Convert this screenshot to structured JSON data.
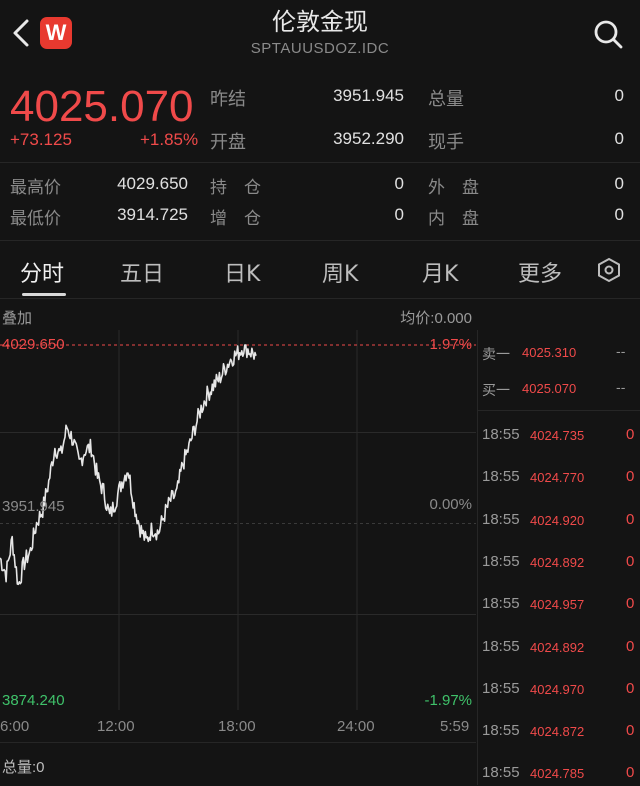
{
  "header": {
    "title": "伦敦金现",
    "code": "SPTAUUSDOZ.IDC",
    "logo_text": "W",
    "back_icon": "chevron-left-icon",
    "search_icon": "search-icon"
  },
  "quote": {
    "price": "4025.070",
    "change": "+73.125",
    "change_pct": "+1.85%",
    "fields": [
      {
        "label": "昨结",
        "value": "3951.945"
      },
      {
        "label": "开盘",
        "value": "3952.290"
      },
      {
        "label": "总量",
        "value": "0"
      },
      {
        "label": "现手",
        "value": "0"
      },
      {
        "label": "最高价",
        "value": "4029.650"
      },
      {
        "label": "最低价",
        "value": "3914.725"
      },
      {
        "label": "持　仓",
        "value": "0"
      },
      {
        "label": "增　仓",
        "value": "0"
      },
      {
        "label": "外　盘",
        "value": "0"
      },
      {
        "label": "内　盘",
        "value": "0"
      }
    ]
  },
  "tabs": [
    {
      "label": "分时",
      "active": true
    },
    {
      "label": "五日"
    },
    {
      "label": "日K"
    },
    {
      "label": "周K"
    },
    {
      "label": "月K"
    },
    {
      "label": "更多"
    }
  ],
  "chart_bar": {
    "overlay_label": "叠加",
    "avg_label": "均价:0.000"
  },
  "chart_data": {
    "type": "line",
    "y_high_label": "4029.650",
    "y_mid_label": "3951.945",
    "y_low_label": "3874.240",
    "pct_high_label": "1.97%",
    "pct_mid_label": "0.00%",
    "pct_low_label": "-1.97%",
    "x_ticks": [
      "6:00",
      "12:00",
      "18:00",
      "24:00",
      "5:59"
    ],
    "ylim": [
      3874.24,
      4029.65
    ],
    "prev_close": 3951.945,
    "values": [
      3937,
      3930,
      3945,
      3925,
      3935,
      3940,
      3952,
      3958,
      3970,
      3985,
      3982,
      3994,
      3988,
      3978,
      3984,
      3985,
      3972,
      3966,
      3955,
      3962,
      3970,
      3976,
      3960,
      3950,
      3944,
      3950,
      3948,
      3956,
      3962,
      3965,
      3978,
      3985,
      3994,
      4002,
      4008,
      4012,
      4015,
      4020,
      4024,
      4026,
      4029,
      4027,
      4025
    ],
    "volume_label": "总量:0"
  },
  "order_book": {
    "ask": {
      "label": "卖一",
      "price": "4025.310",
      "vol": "--"
    },
    "bid": {
      "label": "买一",
      "price": "4025.070",
      "vol": "--"
    }
  },
  "trades": [
    {
      "time": "18:55",
      "price": "4024.735",
      "vol": "0"
    },
    {
      "time": "18:55",
      "price": "4024.770",
      "vol": "0"
    },
    {
      "time": "18:55",
      "price": "4024.920",
      "vol": "0"
    },
    {
      "time": "18:55",
      "price": "4024.892",
      "vol": "0"
    },
    {
      "time": "18:55",
      "price": "4024.957",
      "vol": "0"
    },
    {
      "time": "18:55",
      "price": "4024.892",
      "vol": "0"
    },
    {
      "time": "18:55",
      "price": "4024.970",
      "vol": "0"
    },
    {
      "time": "18:55",
      "price": "4024.872",
      "vol": "0"
    },
    {
      "time": "18:55",
      "price": "4024.785",
      "vol": "0"
    }
  ],
  "colors": {
    "up": "#f04a4a",
    "down": "#3fc26a",
    "line": "#e6e6e6",
    "grid": "#2a2a2a"
  }
}
